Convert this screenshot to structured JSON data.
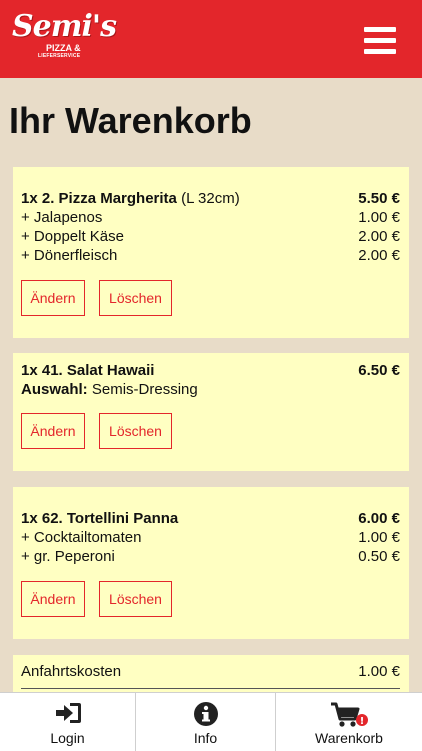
{
  "header": {
    "logo_script": "Semi's",
    "logo_line1": "PIZZA &",
    "logo_line2": "LIEFERSERVICE"
  },
  "page_title": "Ihr Warenkorb",
  "cart": {
    "items": [
      {
        "title_bold": "1x 2. Pizza Margherita",
        "title_note": "(L 32cm)",
        "price": "5.50 €",
        "extras": [
          {
            "label": "+ Jalapenos",
            "price": "1.00 €"
          },
          {
            "label": "+ Doppelt Käse",
            "price": "2.00 €"
          },
          {
            "label": "+ Dönerfleisch",
            "price": "2.00 €"
          }
        ]
      },
      {
        "title_bold": "1x 41. Salat Hawaii",
        "price": "6.50 €",
        "option_label": "Auswahl:",
        "option_value": "Semis-Dressing"
      },
      {
        "title_bold": "1x 62. Tortellini Panna",
        "price": "6.00 €",
        "extras": [
          {
            "label": "+ Cocktailtomaten",
            "price": "1.00 €"
          },
          {
            "label": "+ gr. Peperoni",
            "price": "0.50 €"
          }
        ]
      }
    ],
    "edit_label": "Ändern",
    "delete_label": "Löschen",
    "delivery_label": "Anfahrtskosten",
    "delivery_price": "1.00 €"
  },
  "tabbar": {
    "login": "Login",
    "info": "Info",
    "cart": "Warenkorb",
    "cart_badge": "!"
  },
  "colors": {
    "brand_red": "#e3262b",
    "card_bg": "#ffffc2",
    "page_bg": "#e8dcc8"
  },
  "icons": {
    "menu": "hamburger-menu-icon",
    "login": "login-arrow-icon",
    "info": "info-circle-icon",
    "cart": "shopping-cart-icon"
  }
}
